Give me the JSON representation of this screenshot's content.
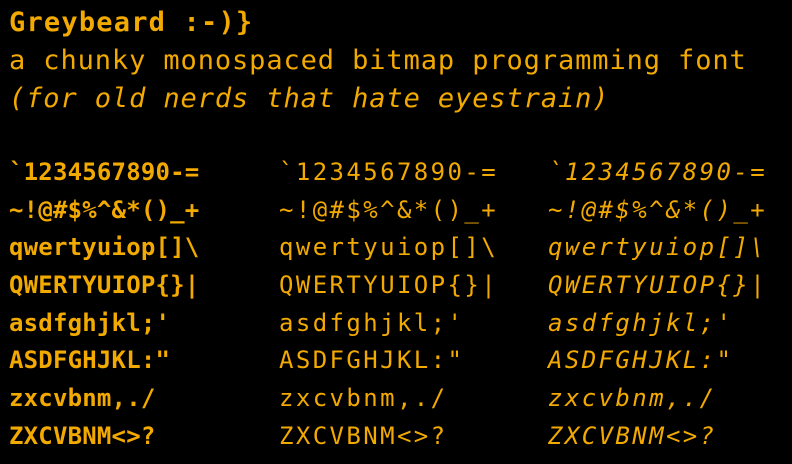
{
  "header": {
    "title": "Greybeard :-)}",
    "tagline": "a chunky monospaced bitmap programming font",
    "subline": "(for old nerds that hate eyestrain)"
  },
  "colors": {
    "background": "#000000",
    "text": "#f2a900"
  },
  "samples": [
    "`1234567890-=",
    "~!@#$%^&*()_+",
    "qwertyuiop[]\\",
    "QWERTYUIOP{}|",
    "asdfghjkl;'",
    "ASDFGHJKL:\"",
    "zxcvbnm,./",
    "ZXCVBNM<>?"
  ]
}
